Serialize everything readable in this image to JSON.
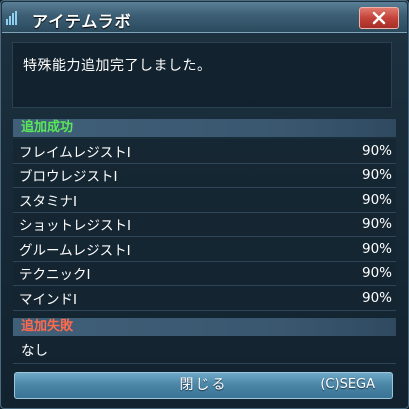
{
  "window": {
    "title": "アイテムラボ"
  },
  "message": "特殊能力追加完了しました。",
  "success": {
    "header": "追加成功",
    "items": [
      {
        "name": "フレイムレジストI",
        "rate": "90%"
      },
      {
        "name": "ブロウレジストI",
        "rate": "90%"
      },
      {
        "name": "スタミナI",
        "rate": "90%"
      },
      {
        "name": "ショットレジストI",
        "rate": "90%"
      },
      {
        "name": "グルームレジストI",
        "rate": "90%"
      },
      {
        "name": "テクニックI",
        "rate": "90%"
      },
      {
        "name": "マインドI",
        "rate": "90%"
      }
    ]
  },
  "failure": {
    "header": "追加失敗",
    "items": [
      {
        "name": "なし"
      }
    ]
  },
  "buttons": {
    "close_label": "閉じる"
  },
  "copyright": "(C)SEGA",
  "colors": {
    "success_header": "#59e85a",
    "failure_header": "#ff6a4e",
    "title_bar": "#3c5e74",
    "close_button": "#c4433a"
  },
  "icons": {
    "title": "window-icon",
    "close": "close-icon"
  }
}
